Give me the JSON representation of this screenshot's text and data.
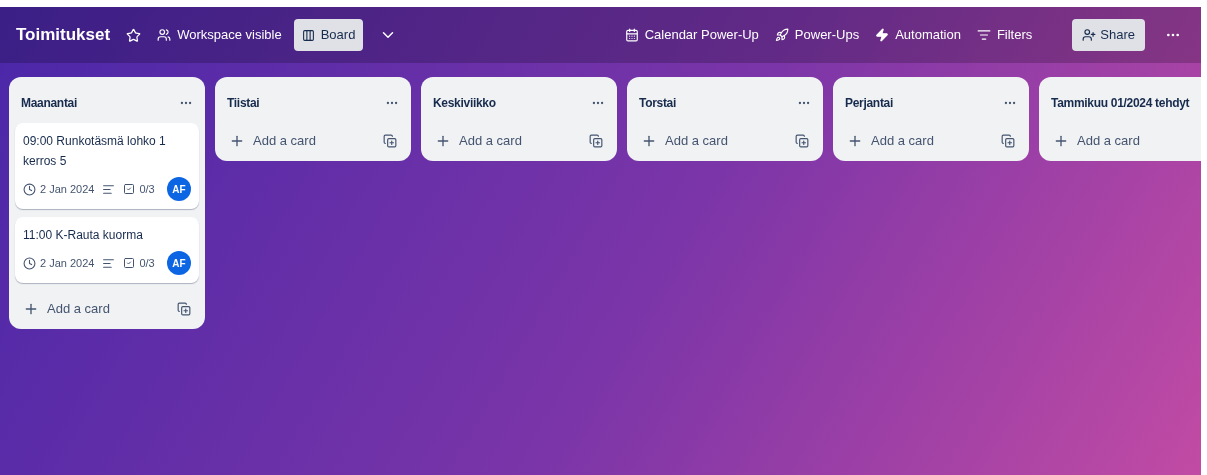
{
  "header": {
    "title": "Toimitukset",
    "visibility": "Workspace visible",
    "view": {
      "label": "Board",
      "selected": true
    },
    "actions": [
      {
        "kind": "calendar",
        "label": "Calendar Power-Up"
      },
      {
        "kind": "powerups",
        "label": "Power-Ups"
      },
      {
        "kind": "automation",
        "label": "Automation"
      },
      {
        "kind": "filters",
        "label": "Filters"
      }
    ],
    "share": "Share"
  },
  "lists": [
    {
      "title": "Maanantai",
      "menu": true,
      "add_card": "Add a card",
      "template": true,
      "cards": [
        {
          "title": "09:00 Runkotäsmä lohko 1 kerros 5",
          "date": "2 Jan 2024",
          "description": true,
          "checklist": "0/3",
          "member": "AF"
        },
        {
          "title": "11:00 K-Rauta kuorma",
          "date": "2 Jan 2024",
          "description": true,
          "checklist": "0/3",
          "member": "AF"
        }
      ]
    },
    {
      "title": "Tiistai",
      "menu": true,
      "add_card": "Add a card",
      "template": true
    },
    {
      "title": "Keskiviikko",
      "menu": true,
      "add_card": "Add a card",
      "template": true
    },
    {
      "title": "Torstai",
      "menu": true,
      "add_card": "Add a card",
      "template": true
    },
    {
      "title": "Perjantai",
      "menu": true,
      "add_card": "Add a card",
      "template": true
    },
    {
      "title": "Tammikuu 01/2024 tehdyt",
      "add_card": "Add a card"
    }
  ]
}
